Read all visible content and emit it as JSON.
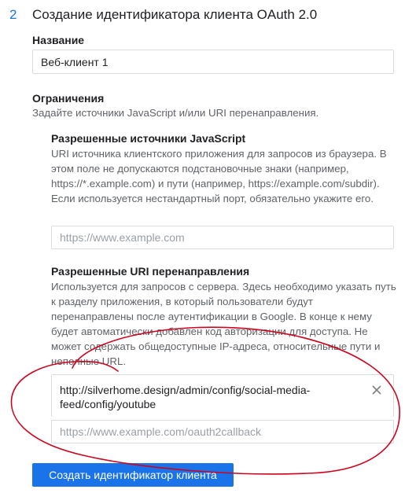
{
  "step": {
    "number": "2",
    "title": "Создание идентификатора клиента OAuth 2.0"
  },
  "name_field": {
    "label": "Название",
    "value": "Веб-клиент 1"
  },
  "restrictions": {
    "title": "Ограничения",
    "description": "Задайте источники JavaScript и/или URI перенаправления."
  },
  "js_origins": {
    "title": "Разрешенные источники JavaScript",
    "help": "URI источника клиентского приложения для запросов из браузера. В этом поле не допускаются подстановочные знаки (например, https://*.example.com) и пути (например, https://example.com/subdir). Если используется нестандартный порт, обязательно укажите его.",
    "placeholder": "https://www.example.com"
  },
  "redirect_uris": {
    "title": "Разрешенные URI перенаправления",
    "help": "Используется для запросов с сервера. Здесь необходимо указать путь к разделу приложения, в который пользователи будут перенаправлены после аутентификации в Google. В конце к нему будет автоматически добавлен код авторизации для доступа. Не может содержать общедоступные IP-адреса, относительные пути и неполные URL.",
    "entered_uri": "http://silverhome.design/admin/config/social-media-feed/config/youtube",
    "placeholder": "https://www.example.com/oauth2callback"
  },
  "icons": {
    "clear": "close-icon"
  },
  "actions": {
    "create_label": "Создать идентификатор клиента"
  },
  "colors": {
    "accent": "#1a73e8",
    "annotation": "#d0021b"
  }
}
